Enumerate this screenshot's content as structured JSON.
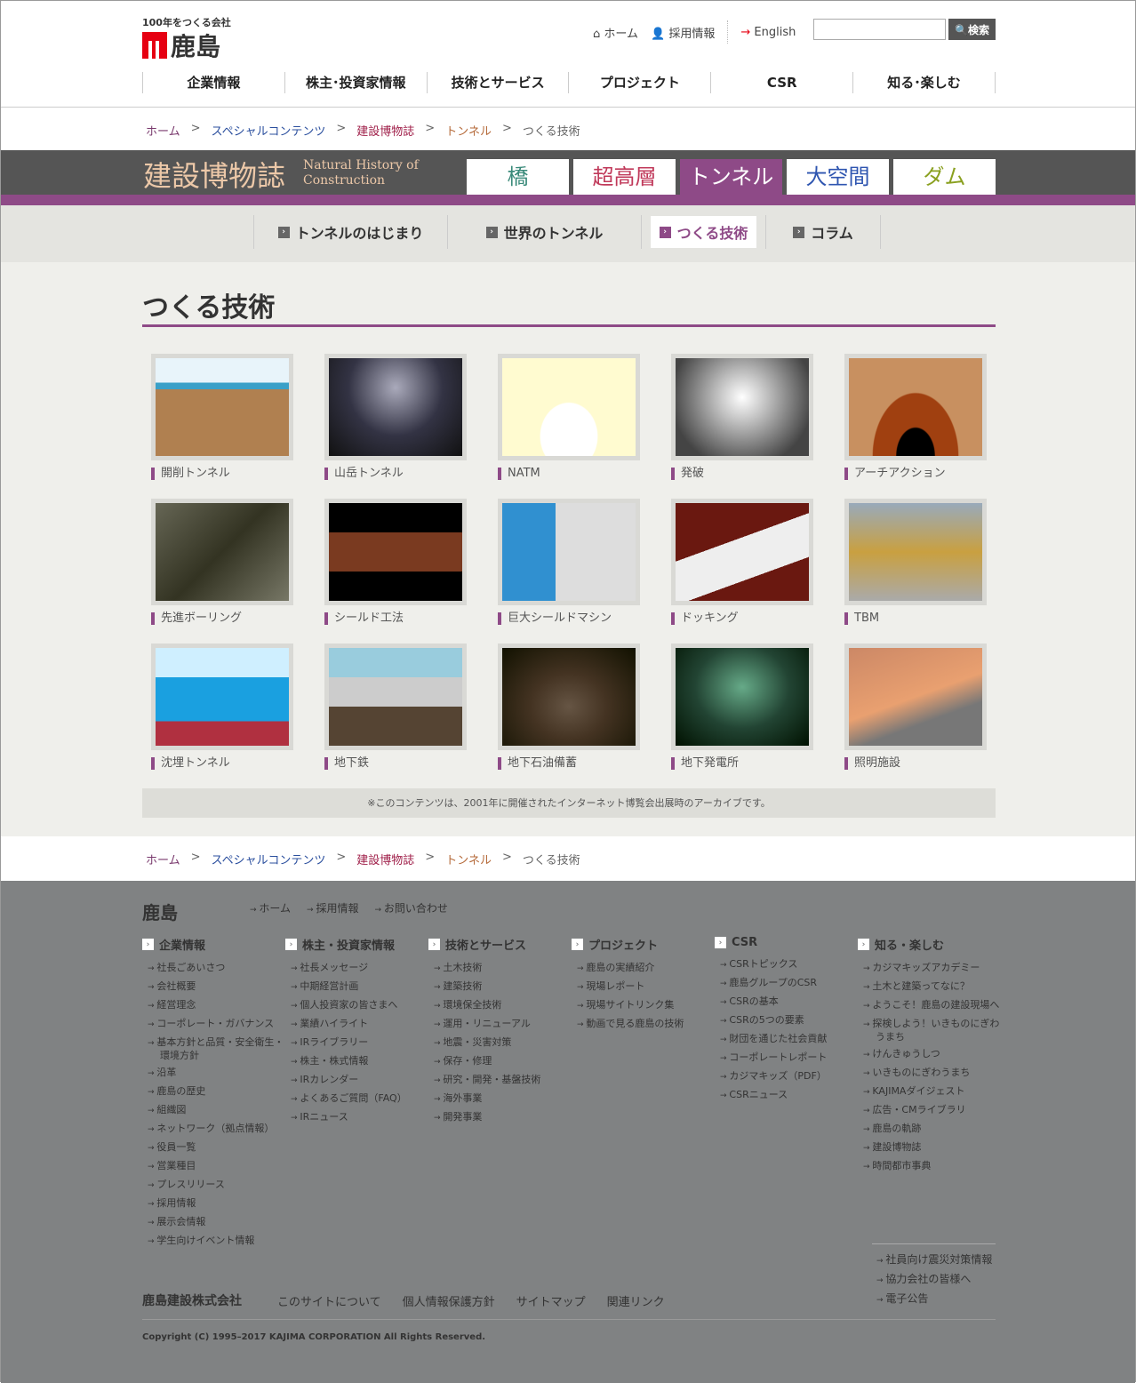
{
  "header": {
    "tagline": "100年をつくる会社",
    "logo": "鹿島",
    "util": {
      "home": "ホーム",
      "recruit": "採用情報",
      "english": "English"
    },
    "search": {
      "placeholder": "",
      "button": "検索"
    },
    "gnav": [
      "企業情報",
      "株主･投資家情報",
      "技術とサービス",
      "プロジェクト",
      "CSR",
      "知る･楽しむ"
    ]
  },
  "breadcrumb": [
    "ホーム",
    "スペシャルコンテンツ",
    "建設博物誌",
    "トンネル",
    "つくる技術"
  ],
  "banner": {
    "title": "建設博物誌",
    "subtitle1": "Natural History of",
    "subtitle2": "Construction",
    "tabs": [
      {
        "label": "橋",
        "color": "#3a8a7a"
      },
      {
        "label": "超高層",
        "color": "#c0395a"
      },
      {
        "label": "トンネル",
        "color": "#ffffff",
        "active": true
      },
      {
        "label": "大空間",
        "color": "#2e55b0"
      },
      {
        "label": "ダム",
        "color": "#8aa020"
      }
    ]
  },
  "subnav": [
    {
      "label": "トンネルのはじまり"
    },
    {
      "label": "世界のトンネル"
    },
    {
      "label": "つくる技術",
      "active": true
    },
    {
      "label": "コラム"
    }
  ],
  "page_title": "つくる技術",
  "tiles": [
    {
      "label": "開削トンネル",
      "bg": "linear-gradient(#e8f4fa 0 25%,#3aa0c8 25% 32%,#b08050 32%)"
    },
    {
      "label": "山岳トンネル",
      "bg": "radial-gradient(ellipse at 50% 30%,#aab 0,#334 50%,#111 100%)"
    },
    {
      "label": "NATM",
      "bg": "radial-gradient(ellipse at 50% 80%,#fff 0 30%,#fffbd0 31%)"
    },
    {
      "label": "発破",
      "bg": "radial-gradient(circle at 50% 40%,#fff 0,#bbb 30%,#444 80%)"
    },
    {
      "label": "アーチアクション",
      "bg": "radial-gradient(ellipse at 50% 100%,#000 0 20%,#a04010 21% 45%,#c89060 46%)"
    },
    {
      "label": "先進ボーリング",
      "bg": "linear-gradient(135deg,#665 0,#332 50%,#776 100%)"
    },
    {
      "label": "シールド工法",
      "bg": "linear-gradient(#000 0 30%,#7a3a20 30% 70%,#000 70%)"
    },
    {
      "label": "巨大シールドマシン",
      "bg": "linear-gradient(90deg,#3090d0 0 40%,#ddd 40%)"
    },
    {
      "label": "ドッキング",
      "bg": "linear-gradient(160deg,#6a1810 0 40%,#eee 40% 70%,#6a1810 70%)"
    },
    {
      "label": "TBM",
      "bg": "linear-gradient(#9ab 0,#c9a040 50%,#aaa 100%)"
    },
    {
      "label": "沈埋トンネル",
      "bg": "linear-gradient(#cfefff 0 30%,#1aa0e0 30% 75%,#b03040 75%)"
    },
    {
      "label": "地下鉄",
      "bg": "linear-gradient(#9cd 0 30%,#ccc 30% 60%,#543 60%)"
    },
    {
      "label": "地下石油備蓄",
      "bg": "radial-gradient(ellipse at 50% 60%,#654 0,#432 40%,#110 100%)"
    },
    {
      "label": "地下発電所",
      "bg": "radial-gradient(ellipse at 50% 40%,#6a8 0,#243 50%,#010 100%)"
    },
    {
      "label": "照明施設",
      "bg": "linear-gradient(160deg,#c86 0,#e9a070 50%,#777 70%)"
    }
  ],
  "note": "※このコンテンツは、2001年に開催されたインターネット博覧会出展時のアーカイブです。",
  "footer": {
    "logo": "鹿島",
    "links": [
      "ホーム",
      "採用情報",
      "お問い合わせ"
    ],
    "columns": [
      {
        "title": "企業情報",
        "items": [
          "社長ごあいさつ",
          "会社概要",
          "経営理念",
          "コーポレート・ガバナンス",
          "基本方針と品質・安全衛生・環境方針",
          "沿革",
          "鹿島の歴史",
          "組織図",
          "ネットワーク（拠点情報）",
          "役員一覧",
          "営業種目",
          "プレスリリース",
          "採用情報",
          "展示会情報",
          "学生向けイベント情報"
        ]
      },
      {
        "title": "株主・投資家情報",
        "items": [
          "社長メッセージ",
          "中期経営計画",
          "個人投資家の皆さまへ",
          "業績ハイライト",
          "IRライブラリー",
          "株主・株式情報",
          "IRカレンダー",
          "よくあるご質問（FAQ）",
          "IRニュース"
        ]
      },
      {
        "title": "技術とサービス",
        "items": [
          "土木技術",
          "建築技術",
          "環境保全技術",
          "運用・リニューアル",
          "地震・災害対策",
          "保存・修理",
          "研究・開発・基盤技術",
          "海外事業",
          "開発事業"
        ]
      },
      {
        "title": "プロジェクト",
        "items": [
          "鹿島の実績紹介",
          "現場レポート",
          "現場サイトリンク集",
          "動画で見る鹿島の技術"
        ]
      },
      {
        "title": "CSR",
        "items": [
          "CSRトピックス",
          "鹿島グループのCSR",
          "CSRの基本",
          "CSRの5つの要素",
          "財団を通じた社会貢献",
          "コーポレートレポート",
          "カジマキッズ（PDF）",
          "CSRニュース"
        ]
      },
      {
        "title": "知る・楽しむ",
        "items": [
          "カジマキッズアカデミー",
          "土木と建築ってなに？",
          "ようこそ！鹿島の建設現場へ",
          "探検しよう！いきものにぎわうまち",
          "けんきゅうしつ",
          "いきものにぎわうまち",
          "KAJIMAダイジェスト",
          "広告・CMライブラリ",
          "鹿島の軌跡",
          "建設博物誌",
          "時間都市事典"
        ]
      }
    ],
    "side": [
      "社員向け震災対策情報",
      "協力会社の皆様へ",
      "電子公告"
    ],
    "company": "鹿島建設株式会社",
    "bottom": [
      "このサイトについて",
      "個人情報保護方針",
      "サイトマップ",
      "関連リンク"
    ],
    "copyright": "Copyright (C) 1995–2017 KAJIMA CORPORATION All Rights Reserved."
  }
}
